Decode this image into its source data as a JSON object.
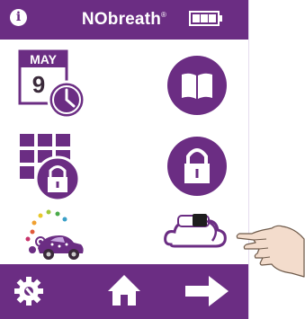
{
  "header": {
    "info_icon": "info-icon",
    "title": "NObreath",
    "trademark": "®",
    "battery_icon": "battery-icon",
    "battery_level": 1.0
  },
  "tiles": [
    {
      "name": "calendar-reminder",
      "icon": "calendar-clock-icon",
      "month": "MAY",
      "day": "9"
    },
    {
      "name": "manual",
      "icon": "open-book-icon"
    },
    {
      "name": "locked-menu",
      "icon": "grid-lock-icon"
    },
    {
      "name": "locked-settings",
      "icon": "padlock-icon"
    },
    {
      "name": "game",
      "icon": "car-game-icon"
    },
    {
      "name": "cloud-sync",
      "icon": "cloud-device-icon"
    }
  ],
  "nav": {
    "settings_icon": "gear-wrench-icon",
    "home_icon": "home-icon",
    "next_icon": "arrow-right-icon"
  },
  "colors": {
    "brand_purple": "#6b2d83",
    "white": "#ffffff"
  },
  "overlay": {
    "pointer_icon": "pointing-hand-icon"
  }
}
